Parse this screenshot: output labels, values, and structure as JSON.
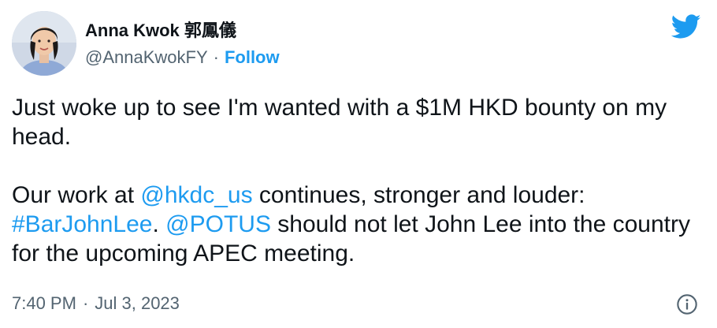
{
  "author": {
    "name": "Anna Kwok 郭鳳儀",
    "handle": "@AnnaKwokFY",
    "separator": "·",
    "follow_label": "Follow"
  },
  "tweet": {
    "line1": "Just woke up to see I'm wanted with a $1M HKD bounty on my head.",
    "p2_a": "Our work at ",
    "mention_hkdc": "@hkdc_us",
    "p2_b": " continues, stronger and louder: ",
    "hashtag": "#BarJohnLee",
    "p2_c": ". ",
    "mention_potus": "@POTUS",
    "p2_d": " should not let John Lee into the country for the upcoming APEC meeting."
  },
  "meta": {
    "time": "7:40 PM",
    "separator": "·",
    "date": "Jul 3, 2023"
  },
  "icons": {
    "brand": "twitter-bird-icon",
    "info": "info-icon"
  },
  "colors": {
    "link": "#1d9bf0",
    "text": "#0f1419",
    "muted": "#536471"
  }
}
